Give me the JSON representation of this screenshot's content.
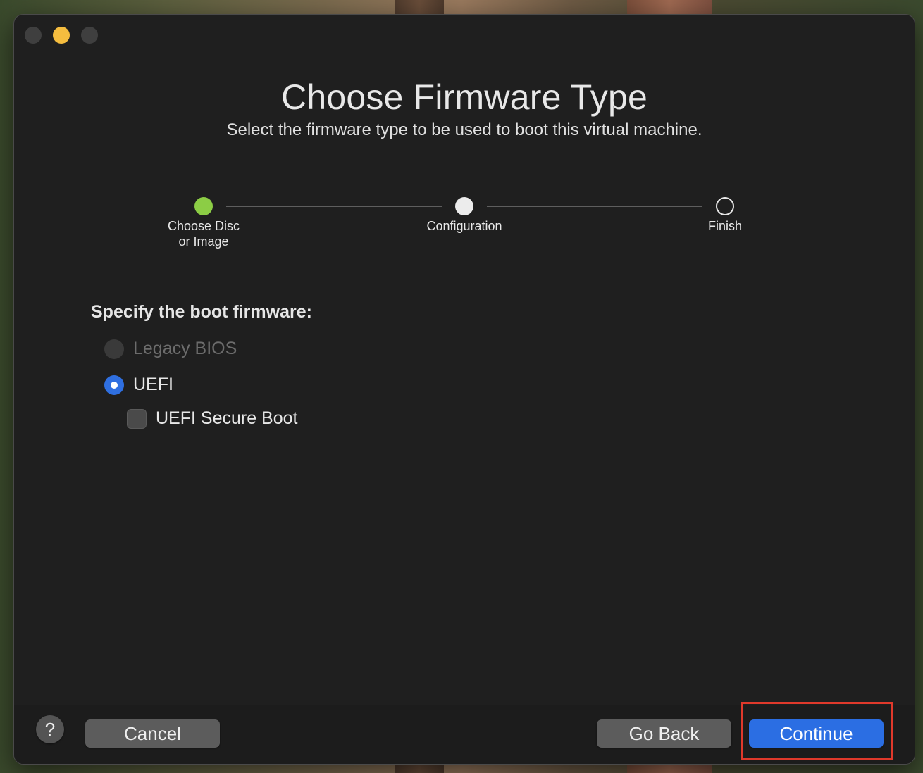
{
  "window": {
    "title": "Choose Firmware Type",
    "subtitle": "Select the firmware type to be used to boot this virtual machine."
  },
  "progress": {
    "steps": [
      {
        "label": "Choose Disc\nor Image",
        "state": "done"
      },
      {
        "label": "Configuration",
        "state": "current"
      },
      {
        "label": "Finish",
        "state": "pending"
      }
    ]
  },
  "firmware": {
    "section_label": "Specify the boot firmware:",
    "options": [
      {
        "label": "Legacy BIOS",
        "state": "disabled"
      },
      {
        "label": "UEFI",
        "state": "selected"
      }
    ],
    "secure_boot": {
      "label": "UEFI Secure Boot",
      "checked": false
    }
  },
  "footer": {
    "help_label": "?",
    "cancel_label": "Cancel",
    "back_label": "Go Back",
    "continue_label": "Continue"
  },
  "colors": {
    "accent": "#2b6ee3",
    "step_done": "#8ccd45",
    "minimize": "#f5bd3f",
    "highlight": "#e0392b"
  }
}
